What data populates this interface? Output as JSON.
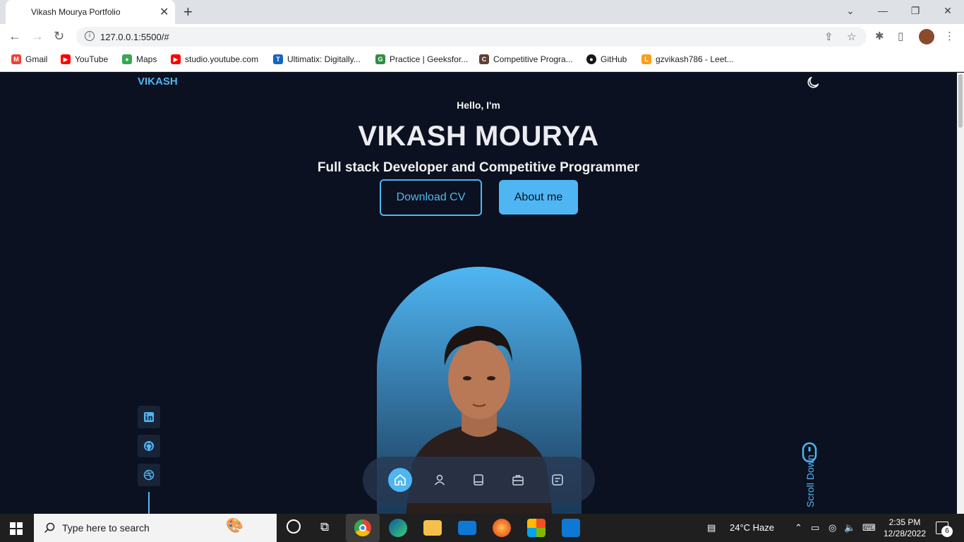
{
  "browser": {
    "tab_title": "Vikash Mourya Portfolio",
    "tab_close": "✕",
    "new_tab": "+",
    "url": "127.0.0.1:5500/#",
    "bookmarks": [
      {
        "label": "Gmail",
        "color": "#ea4335",
        "glyph": "M"
      },
      {
        "label": "YouTube",
        "color": "#ff0000",
        "glyph": "▶"
      },
      {
        "label": "Maps",
        "color": "#34a853",
        "glyph": "●"
      },
      {
        "label": "studio.youtube.com",
        "color": "#ff0000",
        "glyph": "▶"
      },
      {
        "label": "Ultimatix: Digitally...",
        "color": "#1565c0",
        "glyph": "T"
      },
      {
        "label": "Practice | Geeksfor...",
        "color": "#2f8d46",
        "glyph": "G"
      },
      {
        "label": "Competitive Progra...",
        "color": "#5d4037",
        "glyph": "C"
      },
      {
        "label": "GitHub",
        "color": "#181717",
        "glyph": "●"
      },
      {
        "label": "gzvikash786 - Leet...",
        "color": "#f89f1b",
        "glyph": "L"
      }
    ]
  },
  "portfolio": {
    "logo": "VIKASH",
    "greeting": "Hello, I'm",
    "name": "VIKASH MOURYA",
    "role": "Full stack Developer and Competitive Programmer",
    "download_cv": "Download CV",
    "about_me": "About me",
    "scroll_down": "Scroll Down",
    "socials": [
      "linkedin-icon",
      "github-icon",
      "dribbble-icon"
    ],
    "bottom_nav": [
      "home-icon",
      "user-icon",
      "book-icon",
      "briefcase-icon",
      "message-icon"
    ],
    "accent_color": "#4fb6f3",
    "background_color": "#0b1120"
  },
  "taskbar": {
    "search_placeholder": "Type here to search",
    "weather": "24°C  Haze",
    "time": "2:35 PM",
    "date": "12/28/2022",
    "notifications": "6"
  }
}
